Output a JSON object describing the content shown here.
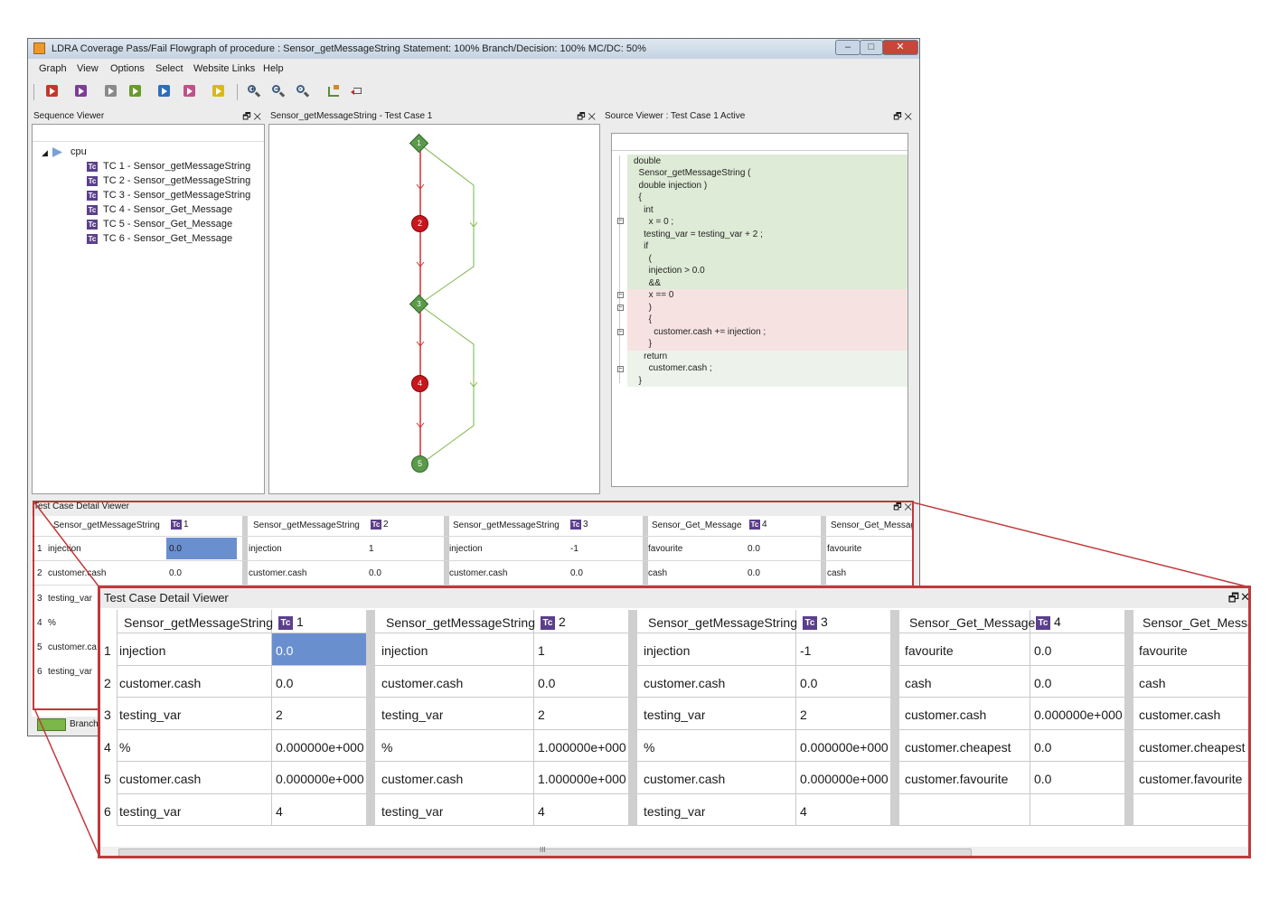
{
  "window": {
    "title": "LDRA Coverage Pass/Fail Flowgraph of procedure : Sensor_getMessageString Statement: 100% Branch/Decision: 100% MC/DC: 50%"
  },
  "menu": [
    "Graph",
    "View",
    "Options",
    "Select",
    "Website Links",
    "Help"
  ],
  "toolbar": {
    "buttons": [
      {
        "icon": "play-red-icon",
        "color": "#c0392b"
      },
      {
        "icon": "play-purple-icon",
        "color": "#7d3c98"
      },
      {
        "icon": "play-grey-icon",
        "color": "#8a8a8a"
      },
      {
        "icon": "play-green-icon",
        "color": "#6a9a2a"
      },
      {
        "icon": "play-blue-icon",
        "color": "#2e6fb8"
      },
      {
        "icon": "play-pink-icon",
        "color": "#c0508a"
      },
      {
        "icon": "play-yellow-icon",
        "color": "#d9b81c"
      }
    ],
    "zoom_in_label": "+",
    "zoom_out_label": "−",
    "zoom_fit_label": "·"
  },
  "sequence_viewer": {
    "title": "Sequence Viewer",
    "root": "cpu",
    "tc_icon_label": "Tc",
    "items": [
      "TC 1 - Sensor_getMessageString",
      "TC 2 - Sensor_getMessageString",
      "TC 3 - Sensor_getMessageString",
      "TC 4 - Sensor_Get_Message",
      "TC 5 - Sensor_Get_Message",
      "TC 6 - Sensor_Get_Message"
    ]
  },
  "flowgraph": {
    "title": "Sensor_getMessageString - Test Case 1",
    "nodes": [
      {
        "label": "1",
        "color": "#5a9a4a"
      },
      {
        "label": "2",
        "color": "#c8161d"
      },
      {
        "label": "3",
        "color": "#5a9a4a"
      },
      {
        "label": "4",
        "color": "#c8161d"
      },
      {
        "label": "5",
        "color": "#5a9a4a"
      }
    ]
  },
  "source_viewer": {
    "title": "Source Viewer : Test Case 1 Active",
    "lines": [
      "double",
      "  Sensor_getMessageString (",
      "  double injection )",
      "  {",
      "    int",
      "      x = 0 ;",
      "    testing_var = testing_var + 2 ;",
      "    if",
      "      (",
      "      injection > 0.0",
      "      &&",
      "      x == 0",
      "      )",
      "      {",
      "        customer.cash += injection ;",
      "      }",
      "    return",
      "      customer.cash ;",
      "  }"
    ]
  },
  "tc_detail_small": {
    "title": "Test Case Detail Viewer",
    "headers": [
      "Sensor_getMessageString",
      "Sensor_getMessageString",
      "Sensor_getMessageString",
      "Sensor_Get_Message",
      "Sensor_Get_Messag"
    ],
    "tc_numbers": [
      "1",
      "2",
      "3",
      "4"
    ],
    "row_numbers": [
      "1",
      "2",
      "3",
      "4",
      "5",
      "6"
    ],
    "rows": [
      [
        "injection",
        "0.0",
        "injection",
        "1",
        "injection",
        "-1",
        "favourite",
        "0.0",
        "favourite"
      ],
      [
        "customer.cash",
        "0.0",
        "customer.cash",
        "0.0",
        "customer.cash",
        "0.0",
        "cash",
        "0.0",
        "cash"
      ]
    ],
    "left_labels": [
      "testing_var",
      "%",
      "customer.ca",
      "testing_var"
    ],
    "status_legend": "Branch"
  },
  "tc_detail_zoom": {
    "title": "Test Case Detail Viewer",
    "tc_icon_label": "Tc",
    "headers": [
      {
        "proc": "Sensor_getMessageString",
        "tc": "1"
      },
      {
        "proc": "Sensor_getMessageString",
        "tc": "2"
      },
      {
        "proc": "Sensor_getMessageString",
        "tc": "3"
      },
      {
        "proc": "Sensor_Get_Message",
        "tc": "4"
      },
      {
        "proc": "Sensor_Get_Messag",
        "tc": ""
      }
    ],
    "row_numbers": [
      "1",
      "2",
      "3",
      "4",
      "5",
      "6"
    ],
    "rows": [
      [
        "injection",
        "0.0",
        "injection",
        "1",
        "injection",
        "-1",
        "favourite",
        "0.0",
        "favourite"
      ],
      [
        "customer.cash",
        "0.0",
        "customer.cash",
        "0.0",
        "customer.cash",
        "0.0",
        "cash",
        "0.0",
        "cash"
      ],
      [
        "testing_var",
        "2",
        "testing_var",
        "2",
        "testing_var",
        "2",
        "customer.cash",
        "0.000000e+000",
        "customer.cash"
      ],
      [
        "%",
        "0.000000e+000",
        "%",
        "1.000000e+000",
        "%",
        "0.000000e+000",
        "customer.cheapest",
        "0.0",
        "customer.cheapest"
      ],
      [
        "customer.cash",
        "0.000000e+000",
        "customer.cash",
        "1.000000e+000",
        "customer.cash",
        "0.000000e+000",
        "customer.favourite",
        "0.0",
        "customer.favourite"
      ],
      [
        "testing_var",
        "4",
        "testing_var",
        "4",
        "testing_var",
        "4",
        "",
        "",
        ""
      ]
    ],
    "scroll_grip": "III"
  },
  "colors": {
    "covered_green": "#deebd6",
    "uncovered_red": "#f6e3e1",
    "highlight_blue": "#6a8fcf",
    "callout_red": "#c0393b"
  }
}
